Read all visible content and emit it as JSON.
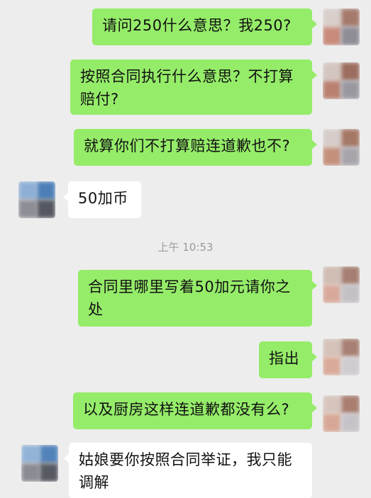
{
  "messages": [
    {
      "dir": "out",
      "text": "请问250什么意思？我250?",
      "avatar": "outgoing-avatar"
    },
    {
      "dir": "out",
      "text": "按照合同执行什么意思？不打算赔付?",
      "avatar": "outgoing-avatar"
    },
    {
      "dir": "out",
      "text": "就算你们不打算赔连道歉也不?",
      "avatar": "outgoing-avatar"
    },
    {
      "dir": "in",
      "text": "50加币",
      "avatar": "incoming-avatar"
    },
    {
      "dir": "out",
      "text": "合同里哪里写着50加元请你之处",
      "avatar": "outgoing-avatar"
    },
    {
      "dir": "out",
      "text": "指出",
      "avatar": "outgoing-avatar"
    },
    {
      "dir": "out",
      "text": "以及厨房这样连道歉都没有么?",
      "avatar": "outgoing-avatar"
    },
    {
      "dir": "in",
      "text": "姑娘要你按照合同举证，我只能调解",
      "avatar": "incoming-avatar"
    }
  ],
  "timestamp": "上午 10:53",
  "colors": {
    "background": "#ededed",
    "outgoing_bubble": "#95ec69",
    "incoming_bubble": "#ffffff",
    "timestamp_text": "#9b9b9b"
  }
}
